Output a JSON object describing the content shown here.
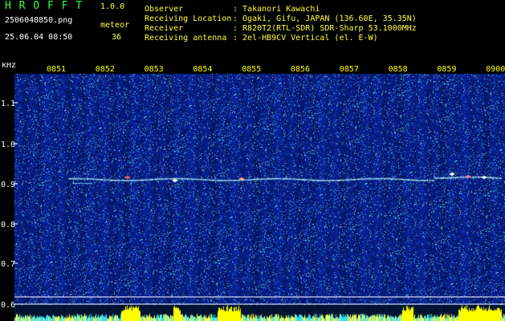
{
  "app": {
    "name": "H R O F F T",
    "version": "1.0.0",
    "filename": "2506040850.png",
    "meteor_label": "meteor",
    "meteor_count": "36",
    "datetime": "25.06.04 08:50"
  },
  "info": {
    "rows": [
      {
        "key": "Observer",
        "value": ": Takanori Kawachi"
      },
      {
        "key": "Receiving Location",
        "value": ": Ogaki, Gifu, JAPAN (136.60E, 35.35N)"
      },
      {
        "key": "Receiver",
        "value": ": R820T2(RTL-SDR) SDR-Sharp 53.1000MHz"
      },
      {
        "key": "Receiving antenna",
        "value": ": 2el-HB9CV Vertical (el. E-W)"
      }
    ]
  },
  "axis": {
    "unit": "kHz",
    "freq_ticks": [
      "1.1",
      "1.0",
      "0.9",
      "0.8",
      "0.7",
      "0.6"
    ],
    "time_ticks": [
      "0851",
      "0852",
      "0853",
      "0854",
      "0855",
      "0856",
      "0857",
      "0858",
      "0859",
      "0900"
    ]
  },
  "colors": {
    "background": "#000000",
    "spectro_base": "#0a1a8c",
    "trace": "#c8ffff",
    "marker_line": "#ffffff",
    "bar": "#ffff00",
    "text_header": "#3cff3c",
    "text_time": "#ffff3c"
  }
}
